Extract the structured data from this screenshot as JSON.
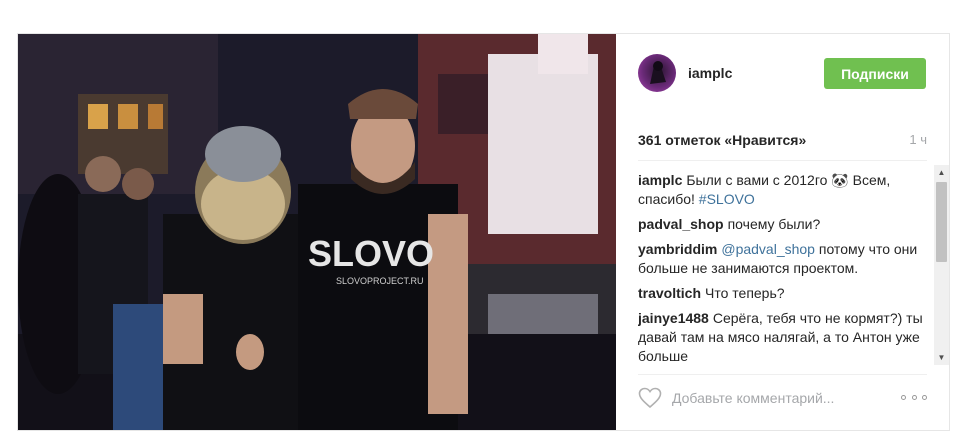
{
  "post": {
    "photo": {
      "shirt_text": "SLOVO",
      "shirt_subtext": "SLOVOPROJECT.RU"
    },
    "header": {
      "username": "iamplc",
      "follow_label": "Подписки"
    },
    "likes": "361 отметок «Нравится»",
    "time": "1 ч",
    "comments": [
      {
        "author": "iamplc",
        "text": "Были с вами с 2012го 🐼 Всем, спасибо!",
        "tag": "#SLOVO"
      },
      {
        "author": "padval_shop",
        "text": "почему были?"
      },
      {
        "author": "yambriddim",
        "mention": "@padval_shop",
        "text": "потому что они больше не занимаются проектом."
      },
      {
        "author": "travoltich",
        "text": "Что теперь?"
      },
      {
        "author": "jainye1488",
        "text": "Серёга, тебя что не кормят?) ты давай там на мясо налягай, а то Антон уже больше"
      }
    ],
    "comment_placeholder": "Добавьте комментарий...",
    "colors": {
      "follow_button": "#70c050",
      "link": "#3f729b",
      "muted": "#a5a7aa"
    },
    "icons": {
      "like": "heart-icon",
      "more": "more-options-icon",
      "scroll_up": "scroll-up-arrow",
      "scroll_down": "scroll-down-arrow"
    }
  }
}
